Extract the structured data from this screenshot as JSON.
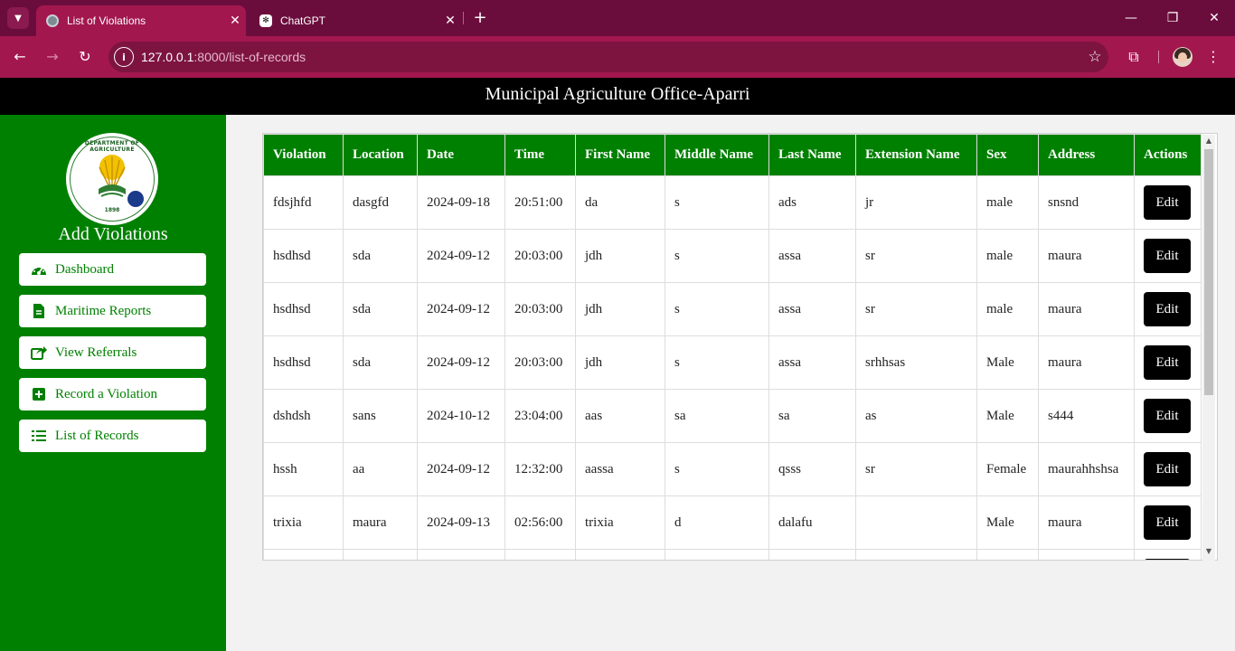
{
  "browser": {
    "tabs": [
      {
        "title": "List of Violations",
        "active": true
      },
      {
        "title": "ChatGPT",
        "active": false
      }
    ],
    "url_host": "127.0.0.1",
    "url_path": ":8000/list-of-records"
  },
  "header": {
    "title": "Municipal Agriculture Office-Aparri"
  },
  "logo": {
    "ring_text": "DEPARTMENT OF AGRICULTURE",
    "year": "1898"
  },
  "sidebar": {
    "title": "Add Violations",
    "items": [
      {
        "label": "Dashboard",
        "icon": "dashboard-icon"
      },
      {
        "label": "Maritime Reports",
        "icon": "file-icon"
      },
      {
        "label": "View Referrals",
        "icon": "share-icon"
      },
      {
        "label": "Record a Violation",
        "icon": "plus-square-icon"
      },
      {
        "label": "List of Records",
        "icon": "list-icon"
      }
    ]
  },
  "table": {
    "headers": [
      "Violation",
      "Location",
      "Date",
      "Time",
      "First Name",
      "Middle Name",
      "Last Name",
      "Extension Name",
      "Sex",
      "Address",
      "Actions"
    ],
    "edit_label": "Edit",
    "rows": [
      [
        "fdsjhfd",
        "dasgfd",
        "2024-09-18",
        "20:51:00",
        "da",
        "s",
        "ads",
        "jr",
        "male",
        "snsnd"
      ],
      [
        "hsdhsd",
        "sda",
        "2024-09-12",
        "20:03:00",
        "jdh",
        "s",
        "assa",
        "sr",
        "male",
        "maura"
      ],
      [
        "hsdhsd",
        "sda",
        "2024-09-12",
        "20:03:00",
        "jdh",
        "s",
        "assa",
        "sr",
        "male",
        "maura"
      ],
      [
        "hsdhsd",
        "sda",
        "2024-09-12",
        "20:03:00",
        "jdh",
        "s",
        "assa",
        "srhhsas",
        "Male",
        "maura"
      ],
      [
        "dshdsh",
        "sans",
        "2024-10-12",
        "23:04:00",
        "aas",
        "sa",
        "sa",
        "as",
        "Male",
        "s444"
      ],
      [
        "hssh",
        "aa",
        "2024-09-12",
        "12:32:00",
        "aassa",
        "s",
        "qsss",
        "sr",
        "Female",
        "maurahhshsa"
      ],
      [
        "trixia",
        "maura",
        "2024-09-13",
        "02:56:00",
        "trixia",
        "d",
        "dalafu",
        "",
        "Male",
        "maura"
      ],
      [
        "",
        "",
        "",
        "",
        "",
        "",
        "",
        "",
        "",
        ""
      ]
    ]
  },
  "colors": {
    "green": "#008000",
    "chrome_dark": "#6b0d3c",
    "chrome": "#a3174f"
  }
}
